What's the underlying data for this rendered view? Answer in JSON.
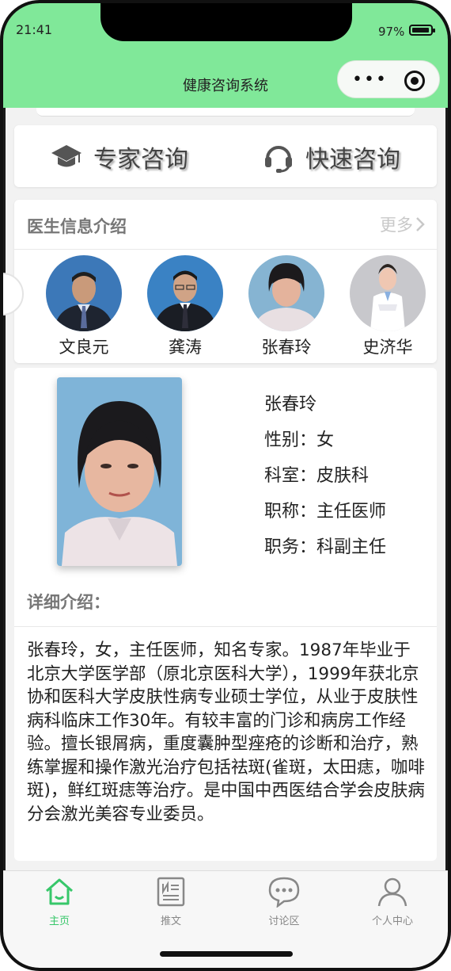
{
  "status_bar": {
    "time": "21:41",
    "battery_percent": "97%",
    "battery_level": 0.97
  },
  "header": {
    "title": "健康咨询系统",
    "capsule_more_icon": "more-dots-icon",
    "capsule_close_icon": "target-close-icon"
  },
  "consult": {
    "expert_label": "专家咨询",
    "expert_icon": "graduation-cap-icon",
    "quick_label": "快速咨询",
    "quick_icon": "headset-icon"
  },
  "doctors_section": {
    "title": "医生信息介绍",
    "more_label": "更多",
    "doctors": [
      {
        "name": "文良元"
      },
      {
        "name": "龚涛"
      },
      {
        "name": "张春玲"
      },
      {
        "name": "史济华"
      }
    ]
  },
  "selected_doctor": {
    "name": "张春玲",
    "gender": "性别：女",
    "department": "科室：皮肤科",
    "title": "职称：主任医师",
    "position": "职务：科副主任",
    "detail_label": "详细介绍：",
    "detail_text": "张春玲，女，主任医师，知名专家。1987年毕业于北京大学医学部（原北京医科大学），1999年获北京协和医科大学皮肤性病专业硕士学位，从业于皮肤性病科临床工作30年。有较丰富的门诊和病房工作经验。擅长银屑病，重度囊肿型痤疮的诊断和治疗，熟练掌握和操作激光治疗包括祛斑(雀斑，太田痣，咖啡斑)，鲜红斑痣等治疗。是中国中西医结合学会皮肤病分会激光美容专业委员。"
  },
  "tabbar": {
    "tabs": [
      {
        "label": "主页",
        "icon": "home-icon"
      },
      {
        "label": "推文",
        "icon": "article-icon"
      },
      {
        "label": "讨论区",
        "icon": "chat-icon"
      },
      {
        "label": "个人中心",
        "icon": "user-icon"
      }
    ],
    "active_color": "#37c76a"
  },
  "colors": {
    "header_bg": "#80e899",
    "accent": "#37c76a"
  }
}
